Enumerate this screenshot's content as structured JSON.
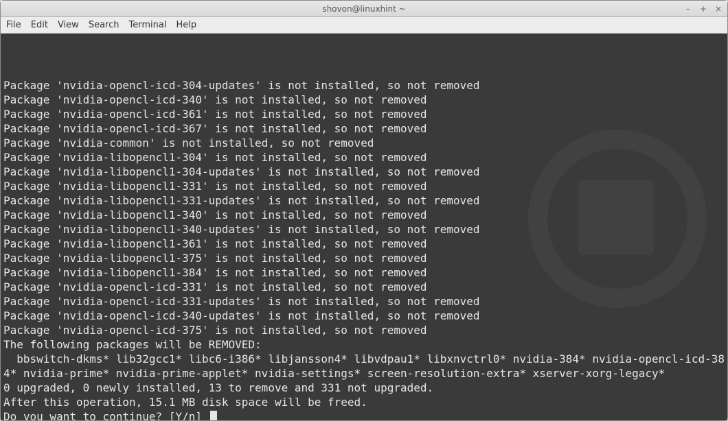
{
  "window": {
    "title": "shovon@linuxhint ~"
  },
  "menubar": {
    "items": [
      "File",
      "Edit",
      "View",
      "Search",
      "Terminal",
      "Help"
    ]
  },
  "terminal": {
    "not_installed_lines": [
      "Package 'nvidia-opencl-icd-304-updates' is not installed, so not removed",
      "Package 'nvidia-opencl-icd-340' is not installed, so not removed",
      "Package 'nvidia-opencl-icd-361' is not installed, so not removed",
      "Package 'nvidia-opencl-icd-367' is not installed, so not removed",
      "Package 'nvidia-common' is not installed, so not removed",
      "Package 'nvidia-libopencl1-304' is not installed, so not removed",
      "Package 'nvidia-libopencl1-304-updates' is not installed, so not removed",
      "Package 'nvidia-libopencl1-331' is not installed, so not removed",
      "Package 'nvidia-libopencl1-331-updates' is not installed, so not removed",
      "Package 'nvidia-libopencl1-340' is not installed, so not removed",
      "Package 'nvidia-libopencl1-340-updates' is not installed, so not removed",
      "Package 'nvidia-libopencl1-361' is not installed, so not removed",
      "Package 'nvidia-libopencl1-375' is not installed, so not removed",
      "Package 'nvidia-libopencl1-384' is not installed, so not removed",
      "Package 'nvidia-opencl-icd-331' is not installed, so not removed",
      "Package 'nvidia-opencl-icd-331-updates' is not installed, so not removed",
      "Package 'nvidia-opencl-icd-340-updates' is not installed, so not removed",
      "Package 'nvidia-opencl-icd-375' is not installed, so not removed"
    ],
    "remove_header": "The following packages will be REMOVED:",
    "remove_list": "  bbswitch-dkms* lib32gcc1* libc6-i386* libjansson4* libvdpau1* libxnvctrl0* nvidia-384* nvidia-opencl-icd-384* nvidia-prime* nvidia-prime-applet* nvidia-settings* screen-resolution-extra* xserver-xorg-legacy*",
    "summary": "0 upgraded, 0 newly installed, 13 to remove and 331 not upgraded.",
    "disk": "After this operation, 15.1 MB disk space will be freed.",
    "prompt": "Do you want to continue? [Y/n] "
  }
}
